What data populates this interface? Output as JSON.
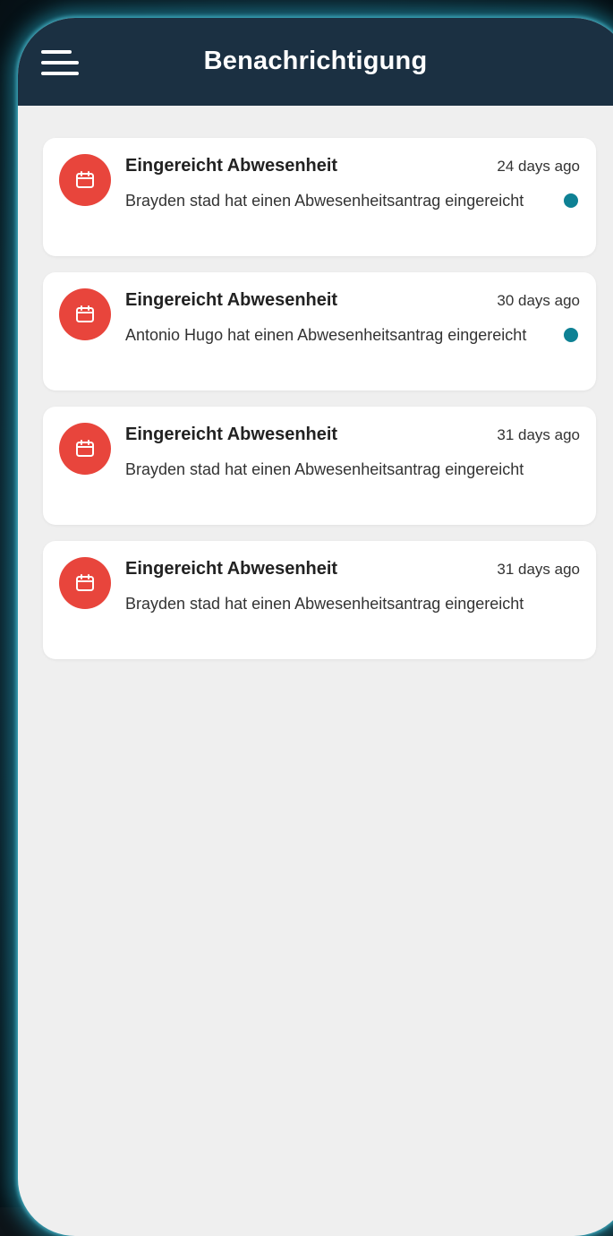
{
  "header": {
    "title": "Benachrichtigung",
    "menu_icon": "hamburger-menu-icon"
  },
  "colors": {
    "header_bg": "#1b3042",
    "page_bg": "#efefef",
    "icon_bg": "#e8453c",
    "unread_dot": "#0e8194"
  },
  "notifications": [
    {
      "icon": "calendar-icon",
      "title": "Eingereicht Abwesenheit",
      "time": "24 days ago",
      "body": "Brayden stad hat einen Abwesenheitsantrag eingereicht",
      "unread": true
    },
    {
      "icon": "calendar-icon",
      "title": "Eingereicht Abwesenheit",
      "time": "30 days ago",
      "body": "Antonio Hugo hat einen Abwesenheitsantrag eingereicht",
      "unread": true
    },
    {
      "icon": "calendar-icon",
      "title": "Eingereicht Abwesenheit",
      "time": "31 days ago",
      "body": "Brayden stad hat einen Abwesenheitsantrag eingereicht",
      "unread": false
    },
    {
      "icon": "calendar-icon",
      "title": "Eingereicht Abwesenheit",
      "time": "31 days ago",
      "body": "Brayden stad hat einen Abwesenheitsantrag eingereicht",
      "unread": false
    }
  ]
}
